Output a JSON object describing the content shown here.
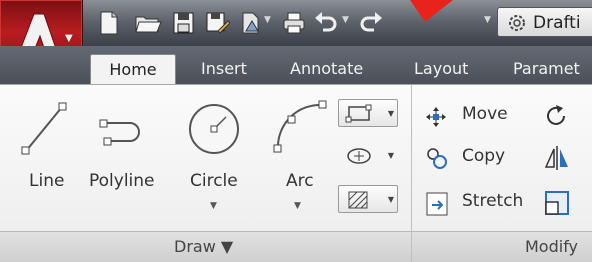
{
  "app": {
    "logo_letter": "A"
  },
  "quick_access": {
    "workspace_label": "Drafti"
  },
  "tabs": [
    {
      "label": "Home"
    },
    {
      "label": "Insert"
    },
    {
      "label": "Annotate"
    },
    {
      "label": "Layout"
    },
    {
      "label": "Paramet"
    }
  ],
  "draw_panel": {
    "title": "Draw ▼",
    "tools": [
      {
        "label": "Line"
      },
      {
        "label": "Polyline"
      },
      {
        "label": "Circle"
      },
      {
        "label": "Arc"
      }
    ]
  },
  "modify_panel": {
    "title": "Modify",
    "tools": [
      {
        "label": "Move"
      },
      {
        "label": "Copy"
      },
      {
        "label": "Stretch"
      }
    ]
  },
  "colors": {
    "accent": "#b81c20",
    "annotation_arrow": "#e8231b",
    "icon_blue": "#2a6ebd"
  }
}
